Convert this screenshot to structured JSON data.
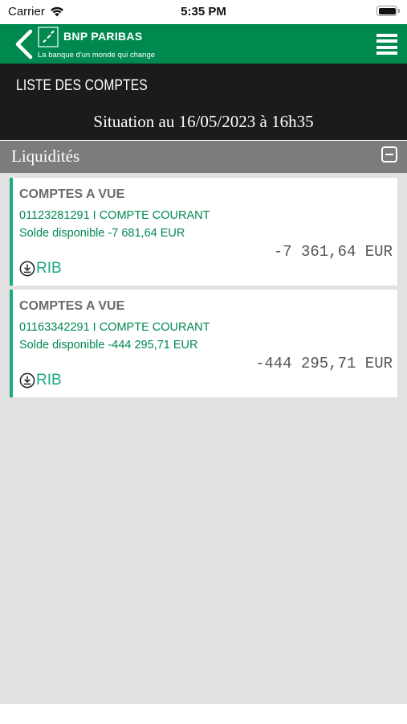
{
  "status_bar": {
    "carrier": "Carrier",
    "time": "5:35 PM"
  },
  "header": {
    "brand_name": "BNP PARIBAS",
    "tagline": "La banque d'un monde qui change"
  },
  "title_band": {
    "page_title": "LISTE DES COMPTES",
    "situation": "Situation au 16/05/2023 à 16h35"
  },
  "section": {
    "title": "Liquidités"
  },
  "accounts": [
    {
      "type": "COMPTES A VUE",
      "name": "01123281291 I COMPTE COURANT",
      "available": "Solde disponible -7 681,64 EUR",
      "balance": "-7 361,64 EUR",
      "rib_label": "RIB"
    },
    {
      "type": "COMPTES A VUE",
      "name": "01163342291 I COMPTE COURANT",
      "available": "Solde disponible -444 295,71 EUR",
      "balance": "-444 295,71 EUR",
      "rib_label": "RIB"
    }
  ],
  "colors": {
    "brand_green": "#00894f",
    "accent_teal": "#1aab86",
    "title_band": "#1b1b1b",
    "section_header": "#7c7c7c"
  },
  "icons": [
    "wifi-icon",
    "battery-icon",
    "back-chevron-icon",
    "bnp-logo-icon",
    "menu-icon",
    "collapse-icon",
    "download-icon"
  ]
}
